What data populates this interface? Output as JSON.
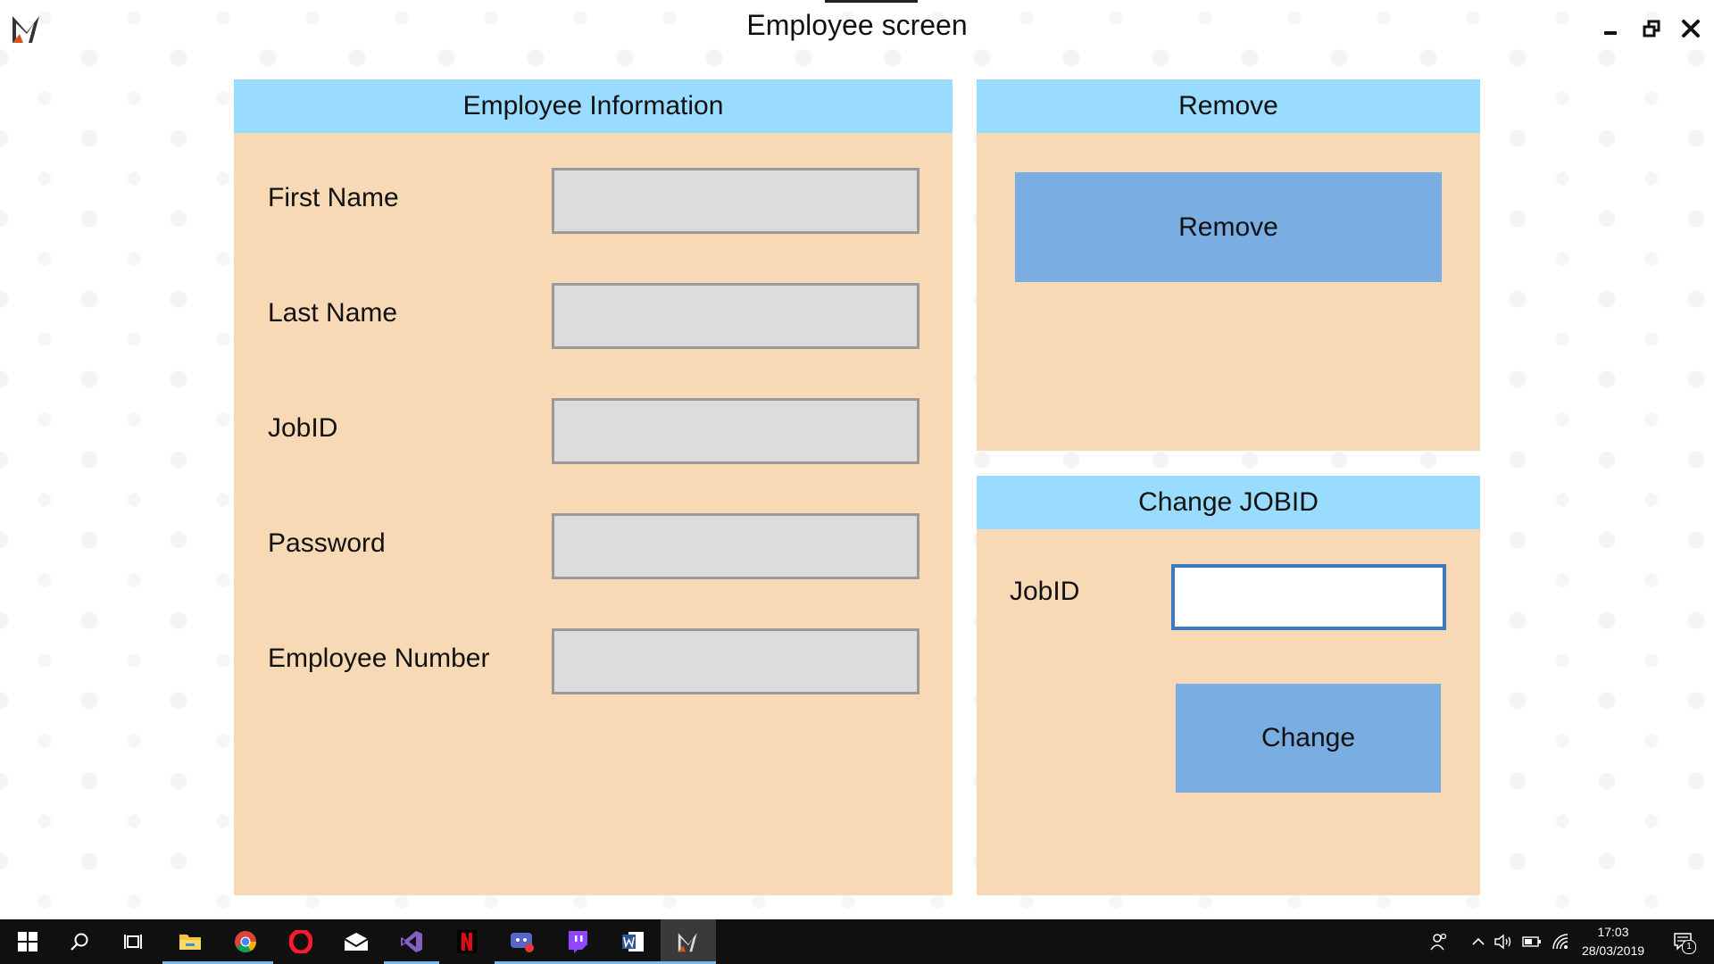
{
  "window": {
    "title": "Employee screen",
    "icons": {
      "logo": "app-logo-icon",
      "minimize": "minimize-icon",
      "restore": "restore-icon",
      "close": "close-icon"
    }
  },
  "employee_info": {
    "header": "Employee Information",
    "fields": [
      {
        "label": "First Name",
        "value": ""
      },
      {
        "label": "Last Name",
        "value": ""
      },
      {
        "label": "JobID",
        "value": ""
      },
      {
        "label": "Password",
        "value": ""
      },
      {
        "label": "Employee Number",
        "value": ""
      }
    ]
  },
  "remove_panel": {
    "header": "Remove",
    "button_label": "Remove"
  },
  "change_jobid_panel": {
    "header": "Change JOBID",
    "jobid_label": "JobID",
    "jobid_value": "",
    "button_label": "Change"
  },
  "taskbar": {
    "apps": [
      "start-icon",
      "search-icon",
      "task-view-icon",
      "file-explorer-icon",
      "chrome-icon",
      "opera-icon",
      "mail-icon",
      "visual-studio-icon",
      "netflix-icon",
      "app-icon",
      "twitch-icon",
      "word-icon",
      "app-logo-icon"
    ],
    "tray": [
      "people-icon",
      "chevron-up-icon",
      "volume-icon",
      "battery-icon",
      "wifi-icon"
    ],
    "time": "17:03",
    "date": "28/03/2019",
    "notification_count": "1",
    "accent_color": "#76b9ed"
  },
  "colors": {
    "panel_bg": "#f8d9b6",
    "header_bg": "#99dcff",
    "button_bg": "#7aade2",
    "field_bg": "#dcdcdc",
    "focus_border": "#3e7ac0"
  }
}
